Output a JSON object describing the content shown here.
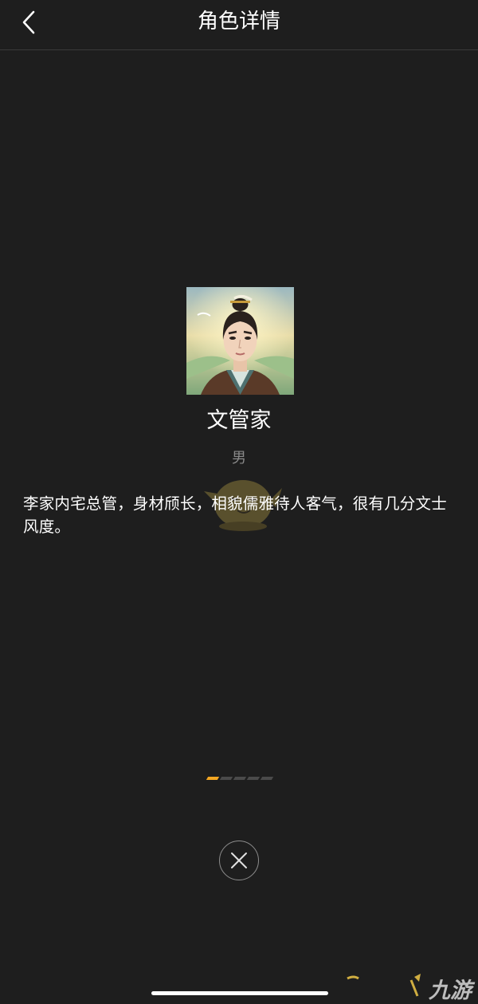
{
  "header": {
    "title": "角色详情",
    "back_icon": "chevron-left-icon"
  },
  "character": {
    "name": "文管家",
    "gender": "男",
    "description": "李家内宅总管，身材颀长，相貌儒雅待人客气，很有几分文士风度。",
    "portrait_icon": "character-portrait"
  },
  "pager": {
    "total": 5,
    "current": 1,
    "active_color": "#f2a622",
    "inactive_color": "#4a4a4a"
  },
  "close_button": {
    "icon": "close-icon"
  },
  "watermark": {
    "logo_icon": "nine-games-logo-icon",
    "text": "九游"
  },
  "colors": {
    "background": "#1e1e1e",
    "text": "#ffffff",
    "secondary_text": "#8a8a8a"
  }
}
